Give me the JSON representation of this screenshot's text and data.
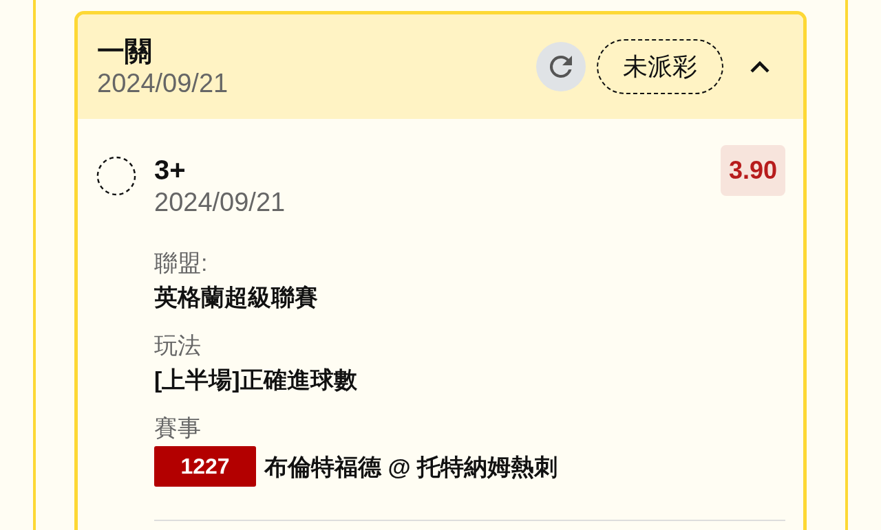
{
  "bet": {
    "title": "一關",
    "date": "2024/09/21",
    "status": "未派彩",
    "expanded": true
  },
  "selection": {
    "name": "3+",
    "date": "2024/09/21",
    "odds": "3.90",
    "checked": false
  },
  "details": [
    {
      "label": "聯盟:",
      "value": "英格蘭超級聯賽"
    },
    {
      "label": "玩法",
      "value": "[上半場]正確進球數"
    },
    {
      "label": "賽事",
      "match_no": "1227",
      "value": "布倫特福德 @ 托特納姆熱刺"
    }
  ]
}
